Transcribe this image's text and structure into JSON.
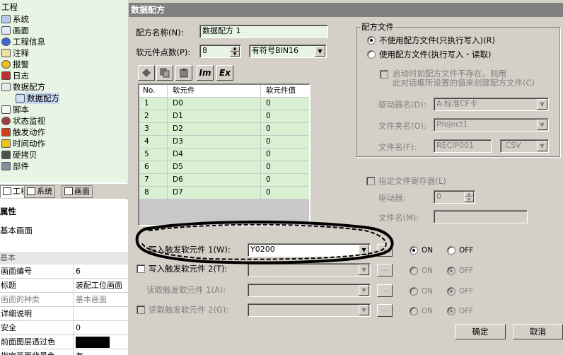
{
  "tree": {
    "root": "工程",
    "items": [
      {
        "label": "系统",
        "icon": "system-icon"
      },
      {
        "label": "画面",
        "icon": "screen-icon"
      },
      {
        "label": "工程信息",
        "icon": "info-icon"
      },
      {
        "label": "注释",
        "icon": "comment-icon"
      },
      {
        "label": "报警",
        "icon": "alarm-icon"
      },
      {
        "label": "日志",
        "icon": "log-icon"
      },
      {
        "label": "数据配方",
        "icon": "recipe-icon"
      },
      {
        "label": "数据配方",
        "icon": "recipe-item-icon"
      },
      {
        "label": "脚本",
        "icon": "script-icon"
      },
      {
        "label": "状态监视",
        "icon": "eye-icon"
      },
      {
        "label": "触发动作",
        "icon": "trigger-icon"
      },
      {
        "label": "时间动作",
        "icon": "clock-warning-icon"
      },
      {
        "label": "硬拷贝",
        "icon": "hardcopy-icon"
      },
      {
        "label": "部件",
        "icon": "part-icon"
      }
    ]
  },
  "panel_tabs": [
    "工程",
    "系统",
    "画面"
  ],
  "properties": {
    "header": "属性",
    "subject": "基本画面",
    "section": "基本",
    "rows": [
      {
        "key": "画面编号",
        "value": "6"
      },
      {
        "key": "标题",
        "value": "装配工位画面"
      },
      {
        "key": "画面的种类",
        "value": "基本画面"
      },
      {
        "key": "详细说明",
        "value": ""
      },
      {
        "key": "安全",
        "value": "0"
      },
      {
        "key": "前面图层透过色",
        "value": ""
      },
      {
        "key": "指定画面背景色",
        "value": "有"
      }
    ]
  },
  "dialog": {
    "title": "数据配方",
    "name_label": "配方名称(N):",
    "name_value": "数据配方 1",
    "points_label": "软元件点数(P):",
    "points_value": "8",
    "data_type": "有符号BIN16",
    "toolbar_text": [
      "Im",
      "Ex"
    ],
    "table": {
      "headers": [
        "No.",
        "软元件",
        "软元件值"
      ],
      "rows": [
        [
          "1",
          "D0",
          "0"
        ],
        [
          "2",
          "D1",
          "0"
        ],
        [
          "3",
          "D2",
          "0"
        ],
        [
          "4",
          "D3",
          "0"
        ],
        [
          "5",
          "D4",
          "0"
        ],
        [
          "6",
          "D5",
          "0"
        ],
        [
          "7",
          "D6",
          "0"
        ],
        [
          "8",
          "D7",
          "0"
        ]
      ]
    },
    "recipe_file": {
      "group_label": "配方文件",
      "opt_no_file": "不使用配方文件(只执行写入)(R)",
      "opt_use_file": "使用配方文件(执行写入・读取)",
      "create_file_line1": "启动时如配方文件不存在，则用",
      "create_file_line2": "此对话框所设置的值来创建配方文件(C)",
      "drive_label": "驱动器名(D):",
      "drive_value": "A:标准CF卡",
      "folder_label": "文件夹名(O):",
      "folder_value": "Project1",
      "file_label": "文件名(F):",
      "file_value": "RECIP001",
      "ext_value": ".CSV"
    },
    "file_register": {
      "label": "指定文件寄存器(L)",
      "drive_label": "驱动器:",
      "drive_value": "0",
      "file_label": "文件名(M):",
      "file_value": ""
    },
    "triggers": [
      {
        "label": "写入触发软元件 1(W):",
        "value": "Y0200",
        "on": "ON",
        "off": "OFF"
      },
      {
        "label": "写入触发软元件 2(T):",
        "value": "",
        "on": "ON",
        "off": "OFF"
      },
      {
        "label": "读取触发软元件 1(A):",
        "value": "",
        "on": "ON",
        "off": "OFF"
      },
      {
        "label": "读取触发软元件 2(G):",
        "value": "",
        "on": "ON",
        "off": "OFF"
      }
    ],
    "browse_label": "...",
    "ok": "确定",
    "cancel": "取消"
  }
}
